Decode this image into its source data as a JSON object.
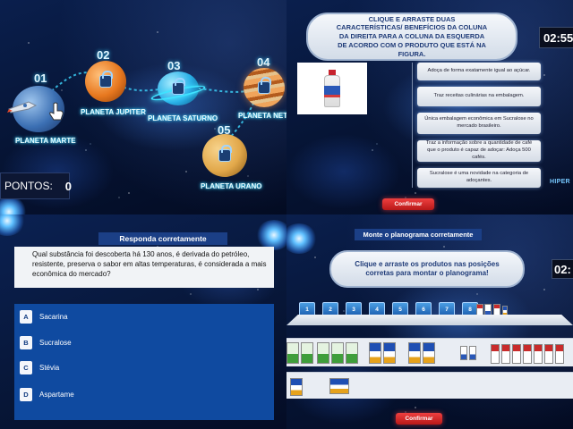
{
  "map": {
    "planets": [
      {
        "num": "01",
        "name": "PLANETA MARTE",
        "color": "#3b6fb3",
        "locked": false
      },
      {
        "num": "02",
        "name": "PLANETA JUPITER",
        "color": "#e7781f",
        "locked": true
      },
      {
        "num": "03",
        "name": "PLANETA SATURNO",
        "color": "#2ab0e8",
        "locked": true
      },
      {
        "num": "04",
        "name": "PLANETA NETUNO",
        "color": "#d9772b",
        "locked": true
      },
      {
        "num": "05",
        "name": "PLANETA URANO",
        "color": "#e2a84a",
        "locked": true
      }
    ],
    "points_label": "PONTOS:",
    "points_value": "0"
  },
  "drag": {
    "instruction": "CLIQUE E ARRASTE DUAS CARACTERÍSTICAS/ BENEFÍCIOS DA COLUNA DA DIREITA PARA A COLUNA DA ESQUERDA DE ACORDO COM O PRODUTO QUE ESTÁ NA FIGURA.",
    "timer": "02:55",
    "options": [
      "Adoça de forma exatamente igual ao açúcar.",
      "Traz receitas culinárias na embalagem.",
      "Única embalagem econômica em Sucralose no mercado brasileiro.",
      "Traz a informação sobre a quantidade de café que o produto é capaz de adoçar: Adoça 500 cafés.",
      "Sucralose é uma novidade na categoria de adoçantes."
    ],
    "confirm_label": "Confirmar",
    "brand_corner": "HIPER"
  },
  "quiz": {
    "header": "Responda corretamente",
    "question": "Qual substância foi descoberta há 130 anos, é derivada do petróleo, resistente, preserva o sabor em altas temperaturas, é considerada a mais econômica do mercado?",
    "answers": [
      {
        "letter": "A",
        "text": "Sacarina"
      },
      {
        "letter": "B",
        "text": "Sucralose"
      },
      {
        "letter": "C",
        "text": "Stévia"
      },
      {
        "letter": "D",
        "text": "Aspartame"
      }
    ]
  },
  "planogram": {
    "header": "Monte o planograma corretamente",
    "instruction": "Clique e arraste os produtos nas posições corretas para montar o planograma!",
    "timer": "02:",
    "slots": [
      "1",
      "2",
      "3",
      "4",
      "5",
      "6",
      "7",
      "8"
    ],
    "confirm_label": "Confirmar"
  }
}
